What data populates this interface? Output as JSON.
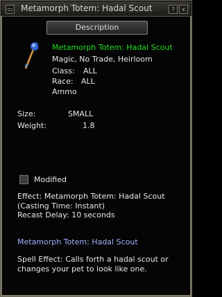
{
  "window": {
    "title": "Metamorph Totem: Hadal Scout",
    "minimize_glyph": "?",
    "close_glyph": "x"
  },
  "description_button": "Description",
  "item": {
    "name": "Metamorph Totem: Hadal Scout",
    "flags": "Magic, No Trade, Heirloom",
    "class_label": "Class:",
    "class_value": "ALL",
    "race_label": "Race:",
    "race_value": "ALL",
    "type": "Ammo",
    "size_label": "Size:",
    "size_value": "SMALL",
    "weight_label": "Weight:",
    "weight_value": "1.8",
    "icon": "totem-wand-icon"
  },
  "modified_label": "Modified",
  "effect": {
    "line1": "Effect: Metamorph Totem: Hadal Scout",
    "line2": "(Casting Time: Instant)",
    "line3": "Recast Delay: 10 seconds"
  },
  "spell": {
    "name": "Metamorph Totem: Hadal Scout",
    "desc_line1": "Spell Effect: Calls forth a hadal scout or",
    "desc_line2": "changes your pet to look like one."
  },
  "colors": {
    "item_name": "#20e020",
    "spell_name": "#a0b0ff",
    "text": "#e8e8e8"
  }
}
